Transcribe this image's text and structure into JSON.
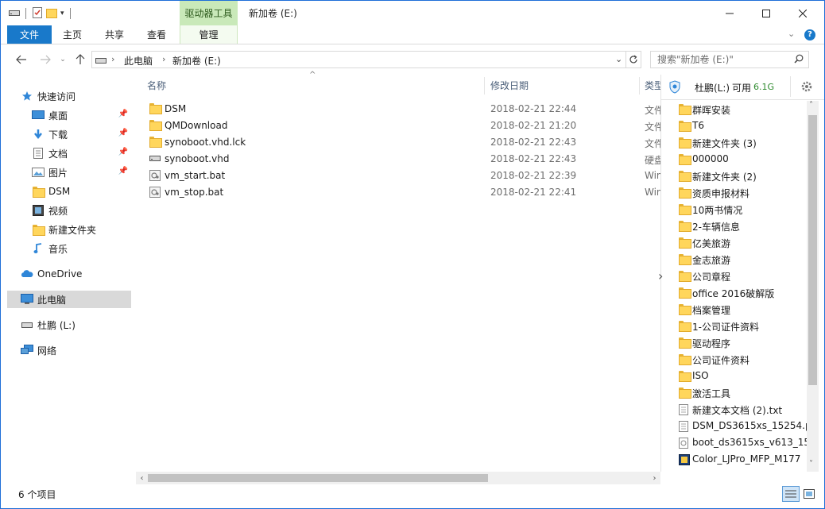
{
  "window": {
    "title": "新加卷 (E:)",
    "context_tab_header": "驱动器工具"
  },
  "ribbon": {
    "tabs": [
      "文件",
      "主页",
      "共享",
      "查看",
      "管理"
    ]
  },
  "address": {
    "segments": [
      "此电脑",
      "新加卷 (E:)"
    ],
    "search_placeholder": "搜索\"新加卷 (E:)\""
  },
  "nav": {
    "quick_access": "快速访问",
    "items": [
      {
        "label": "桌面",
        "icon": "desktop-icon",
        "pinned": true
      },
      {
        "label": "下载",
        "icon": "download-icon",
        "pinned": true
      },
      {
        "label": "文档",
        "icon": "document-icon",
        "pinned": true
      },
      {
        "label": "图片",
        "icon": "picture-icon",
        "pinned": true
      },
      {
        "label": "DSM",
        "icon": "folder-icon",
        "pinned": false
      },
      {
        "label": "视频",
        "icon": "video-icon",
        "pinned": false
      },
      {
        "label": "新建文件夹",
        "icon": "folder-icon",
        "pinned": false
      },
      {
        "label": "音乐",
        "icon": "music-icon",
        "pinned": false
      }
    ],
    "onedrive": "OneDrive",
    "this_pc": "此电脑",
    "drive_l": "杜鹏 (L:)",
    "network": "网络"
  },
  "columns": {
    "name": "名称",
    "date": "修改日期",
    "type": "类型"
  },
  "files": [
    {
      "name": "DSM",
      "date": "2018-02-21 22:44",
      "type": "文件夹",
      "icon": "folder"
    },
    {
      "name": "QMDownload",
      "date": "2018-02-21 21:20",
      "type": "文件夹",
      "icon": "folder"
    },
    {
      "name": "synoboot.vhd.lck",
      "date": "2018-02-21 22:43",
      "type": "文件夹",
      "icon": "folder"
    },
    {
      "name": "synoboot.vhd",
      "date": "2018-02-21 22:43",
      "type": "硬盘",
      "icon": "disk"
    },
    {
      "name": "vm_start.bat",
      "date": "2018-02-21 22:39",
      "type": "Windows",
      "icon": "bat"
    },
    {
      "name": "vm_stop.bat",
      "date": "2018-02-21 22:41",
      "type": "Windows",
      "icon": "bat"
    }
  ],
  "panel": {
    "drive_name": "杜鹏(L:)",
    "free_label": "可用",
    "free_value": "6.1G",
    "items": [
      {
        "name": "群晖安装",
        "icon": "folder"
      },
      {
        "name": "T6",
        "icon": "folder"
      },
      {
        "name": "新建文件夹 (3)",
        "icon": "folder"
      },
      {
        "name": "000000",
        "icon": "folder"
      },
      {
        "name": "新建文件夹 (2)",
        "icon": "folder"
      },
      {
        "name": "资质申报材料",
        "icon": "folder"
      },
      {
        "name": "10两书情况",
        "icon": "folder"
      },
      {
        "name": "2-车辆信息",
        "icon": "folder"
      },
      {
        "name": "亿美旅游",
        "icon": "folder"
      },
      {
        "name": "金志旅游",
        "icon": "folder"
      },
      {
        "name": "公司章程",
        "icon": "folder"
      },
      {
        "name": "office 2016破解版",
        "icon": "folder"
      },
      {
        "name": "档案管理",
        "icon": "folder"
      },
      {
        "name": "1-公司证件资料",
        "icon": "folder"
      },
      {
        "name": "驱动程序",
        "icon": "folder"
      },
      {
        "name": "公司证件资料",
        "icon": "folder"
      },
      {
        "name": "ISO",
        "icon": "folder-iso"
      },
      {
        "name": "激活工具",
        "icon": "folder"
      },
      {
        "name": "新建文本文档 (2).txt",
        "icon": "txt"
      },
      {
        "name": "DSM_DS3615xs_15254.p",
        "icon": "file"
      },
      {
        "name": "boot_ds3615xs_v613_15",
        "icon": "img"
      },
      {
        "name": "Color_LJPro_MFP_M177",
        "icon": "exe"
      }
    ]
  },
  "status": {
    "count": "6 个项目"
  }
}
